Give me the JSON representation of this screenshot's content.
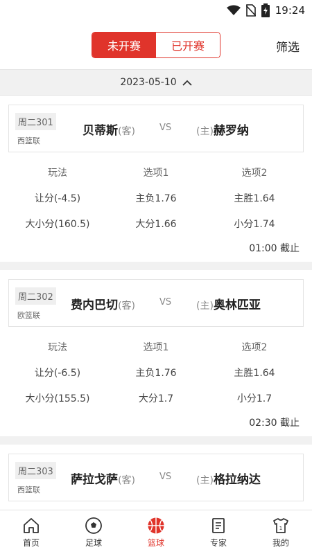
{
  "status": {
    "time": "19:24"
  },
  "tabs": {
    "upcoming": "未开赛",
    "started": "已开赛"
  },
  "filter_label": "筛选",
  "date": "2023-05-10",
  "odds_header": {
    "play": "玩法",
    "opt1": "选项1",
    "opt2": "选项2"
  },
  "matches": [
    {
      "no": "周二301",
      "league": "西篮联",
      "away": "贝蒂斯",
      "away_tag": "(客)",
      "vs": "VS",
      "home_tag": "(主)",
      "home": "赫罗纳",
      "rows": [
        {
          "play": "让分(-4.5)",
          "opt1": "主负1.76",
          "opt2": "主胜1.64"
        },
        {
          "play": "大小分(160.5)",
          "opt1": "大分1.66",
          "opt2": "小分1.74"
        }
      ],
      "deadline": "01:00 截止"
    },
    {
      "no": "周二302",
      "league": "欧篮联",
      "away": "费内巴切",
      "away_tag": "(客)",
      "vs": "VS",
      "home_tag": "(主)",
      "home": "奥林匹亚",
      "rows": [
        {
          "play": "让分(-6.5)",
          "opt1": "主负1.76",
          "opt2": "主胜1.64"
        },
        {
          "play": "大小分(155.5)",
          "opt1": "大分1.7",
          "opt2": "小分1.7"
        }
      ],
      "deadline": "02:30 截止"
    },
    {
      "no": "周二303",
      "league": "西篮联",
      "away": "萨拉戈萨",
      "away_tag": "(客)",
      "vs": "VS",
      "home_tag": "(主)",
      "home": "格拉纳达",
      "rows": [],
      "deadline": ""
    }
  ],
  "nav": [
    {
      "label": "首页",
      "icon": "home-icon"
    },
    {
      "label": "足球",
      "icon": "soccer-ball-icon"
    },
    {
      "label": "篮球",
      "icon": "basketball-icon"
    },
    {
      "label": "专家",
      "icon": "document-icon"
    },
    {
      "label": "我的",
      "icon": "jersey-icon"
    }
  ],
  "colors": {
    "accent": "#e0342b",
    "divider": "#f1f1f1"
  }
}
